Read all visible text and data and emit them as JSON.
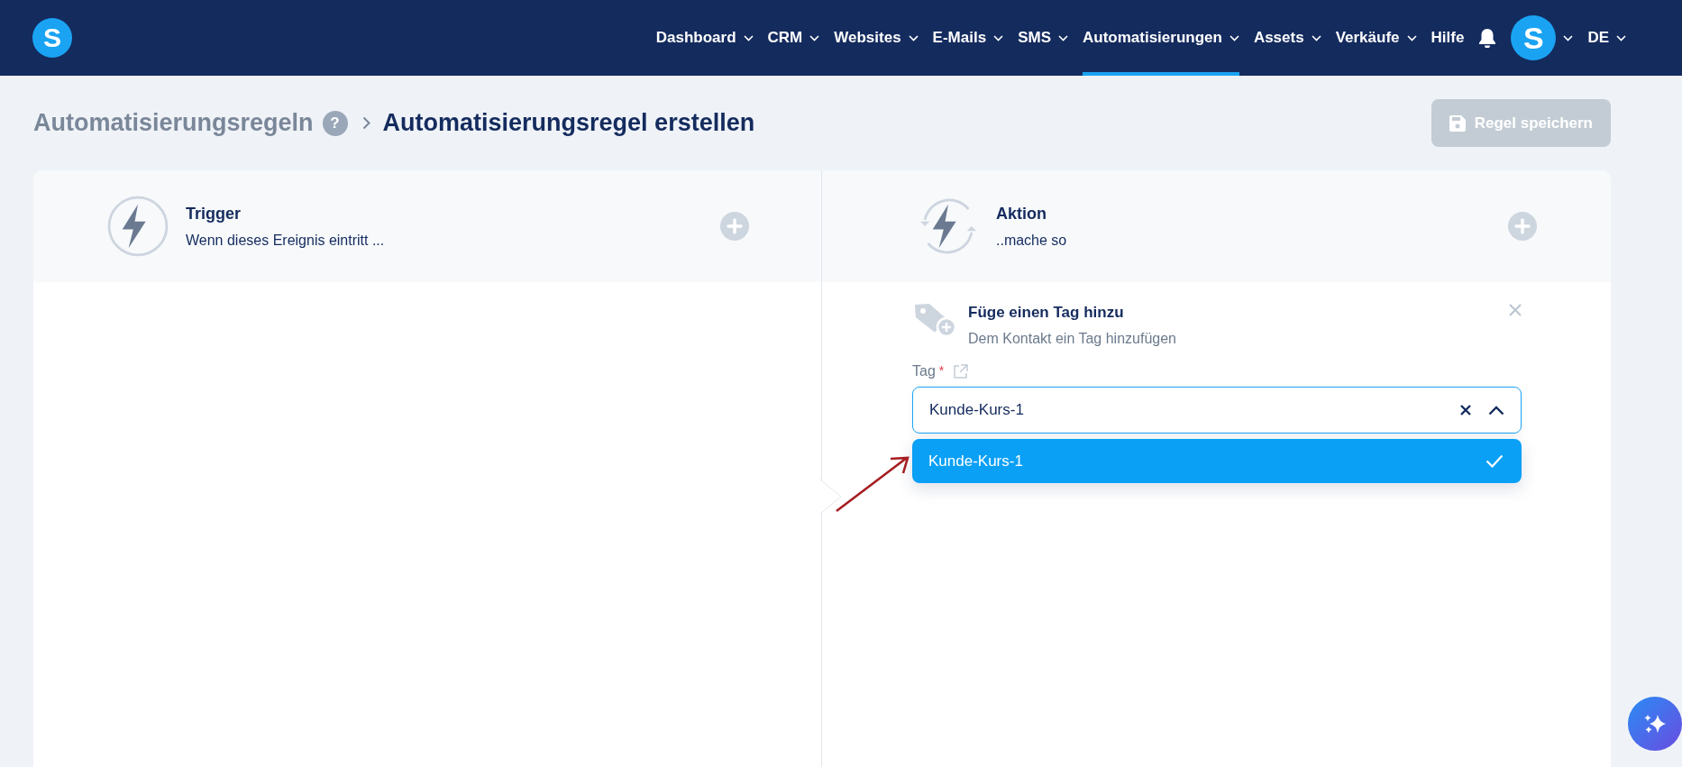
{
  "navbar": {
    "logo_letter": "S",
    "items": [
      {
        "label": "Dashboard",
        "has_menu": true,
        "selected": false
      },
      {
        "label": "CRM",
        "has_menu": true,
        "selected": false
      },
      {
        "label": "Websites",
        "has_menu": true,
        "selected": false
      },
      {
        "label": "E-Mails",
        "has_menu": true,
        "selected": false
      },
      {
        "label": "SMS",
        "has_menu": true,
        "selected": false
      },
      {
        "label": "Automatisierungen",
        "has_menu": true,
        "selected": true
      },
      {
        "label": "Assets",
        "has_menu": true,
        "selected": false
      },
      {
        "label": "Verkäufe",
        "has_menu": true,
        "selected": false
      },
      {
        "label": "Hilfe",
        "has_menu": false,
        "selected": false
      }
    ],
    "avatar_letter": "S",
    "language": "DE"
  },
  "breadcrumb": {
    "parent": "Automatisierungsregeln",
    "help_mark": "?",
    "current": "Automatisierungsregel erstellen"
  },
  "save_button": {
    "label": "Regel speichern",
    "disabled": true
  },
  "trigger": {
    "title": "Trigger",
    "subtitle": "Wenn dieses Ereignis eintritt ..."
  },
  "action": {
    "title": "Aktion",
    "subtitle": "..mache so"
  },
  "action_step": {
    "title": "Füge einen Tag hinzu",
    "subtitle": "Dem Kontakt ein Tag hinzufügen",
    "field": {
      "label": "Tag",
      "required_mark": "*",
      "value": "Kunde-Kurs-1",
      "expanded": true,
      "options": [
        {
          "label": "Kunde-Kurs-1",
          "selected": true
        }
      ]
    }
  }
}
